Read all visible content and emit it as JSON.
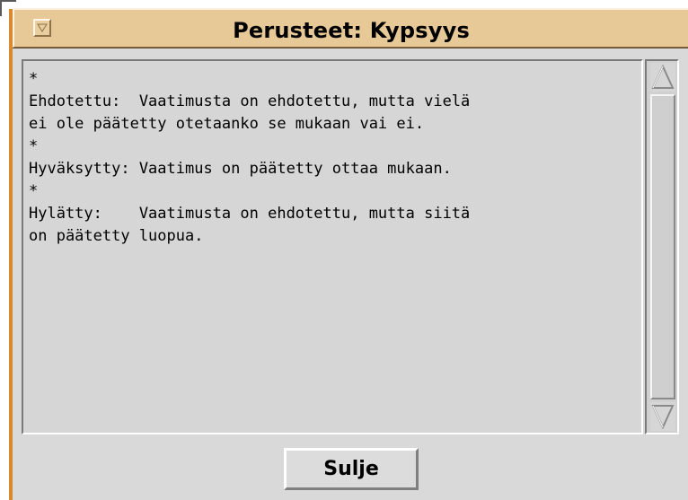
{
  "window": {
    "title": "Perusteet: Kypsyys"
  },
  "content": {
    "text": "*\nEhdotettu:  Vaatimusta on ehdotettu, mutta vielä\nei ole päätetty otetaanko se mukaan vai ei.\n*\nHyväksytty: Vaatimus on päätetty ottaa mukaan.\n*\nHylätty:    Vaatimusta on ehdotettu, mutta siitä\non päätetty luopua."
  },
  "buttons": {
    "close_label": "Sulje"
  },
  "icons": {
    "window_menu": "window-menu-icon",
    "scroll_up": "scroll-up-arrow-icon",
    "scroll_down": "scroll-down-arrow-icon"
  },
  "colors": {
    "accent_orange": "#d98a2f",
    "titlebar": "#e6c996",
    "panel_gray": "#d9d9d9",
    "content_gray": "#d6d6d6"
  }
}
